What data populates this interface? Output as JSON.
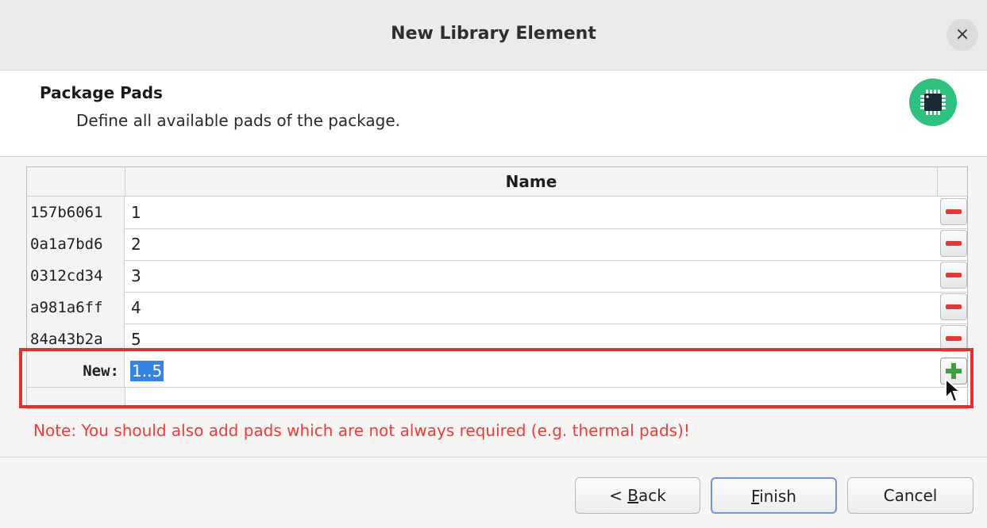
{
  "window": {
    "title": "New Library Element",
    "close_glyph": "×"
  },
  "header": {
    "heading": "Package Pads",
    "subheading": "Define all available pads of the package.",
    "icon": "chip-icon",
    "icon_color": "#2ec27e"
  },
  "table": {
    "column_header": "Name",
    "rows": [
      {
        "id": "157b6061",
        "name": "1"
      },
      {
        "id": "0a1a7bd6",
        "name": "2"
      },
      {
        "id": "0312cd34",
        "name": "3"
      },
      {
        "id": "a981a6ff",
        "name": "4"
      },
      {
        "id": "84a43b2a",
        "name": "5"
      }
    ],
    "new_label": "New:",
    "new_value": "1..5"
  },
  "note": "Note: You should also add pads which are not always required (e.g. thermal pads)!",
  "buttons": {
    "back_prefix": "< ",
    "back_mnemonic": "B",
    "back_rest": "ack",
    "finish_mnemonic": "F",
    "finish_rest": "inish",
    "cancel": "Cancel"
  },
  "colors": {
    "accent": "#3584e4",
    "note": "#f03a3a",
    "highlight": "#e03131",
    "remove": "#e53935",
    "add": "#3ca13c"
  }
}
